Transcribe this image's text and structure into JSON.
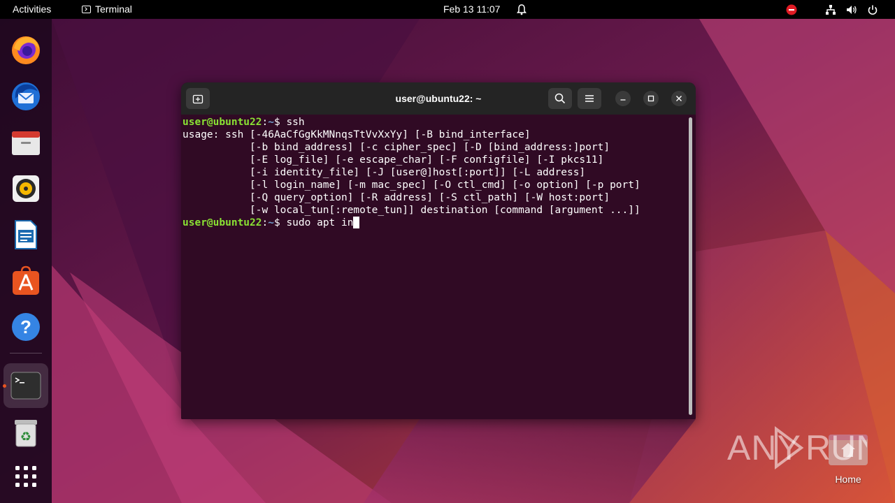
{
  "topbar": {
    "activities": "Activities",
    "app_name": "Terminal",
    "datetime": "Feb 13  11:07",
    "icons": [
      "bell-icon",
      "do-not-disturb-icon",
      "network-icon",
      "volume-icon",
      "power-icon"
    ]
  },
  "dock": {
    "items": [
      "firefox-icon",
      "thunderbird-icon",
      "files-icon",
      "rhythmbox-icon",
      "libreoffice-writer-icon",
      "app-center-icon",
      "help-icon",
      "terminal-icon",
      "trash-icon",
      "show-apps-icon"
    ],
    "running": "terminal-icon"
  },
  "window": {
    "title": "user@ubuntu22: ~"
  },
  "terminal": {
    "prompt_user": "user@ubuntu22",
    "prompt_sep": ":",
    "prompt_path": "~",
    "prompt_sym": "$ ",
    "cmd1": "ssh",
    "output": [
      "usage: ssh [-46AaCfGgKkMNnqsTtVvXxYy] [-B bind_interface]",
      "           [-b bind_address] [-c cipher_spec] [-D [bind_address:]port]",
      "           [-E log_file] [-e escape_char] [-F configfile] [-I pkcs11]",
      "           [-i identity_file] [-J [user@]host[:port]] [-L address]",
      "           [-l login_name] [-m mac_spec] [-O ctl_cmd] [-o option] [-p port]",
      "           [-Q query_option] [-R address] [-S ctl_path] [-W host:port]",
      "           [-w local_tun[:remote_tun]] destination [command [argument ...]]"
    ],
    "cmd2": "sudo apt in"
  },
  "desktop": {
    "home_label": "Home",
    "watermark": "ANY RUN"
  },
  "colors": {
    "terminal_bg": "#300a24",
    "prompt_user": "#8ae234",
    "prompt_path": "#729fcf",
    "headerbar": "#242424",
    "accent": "#e95420"
  }
}
